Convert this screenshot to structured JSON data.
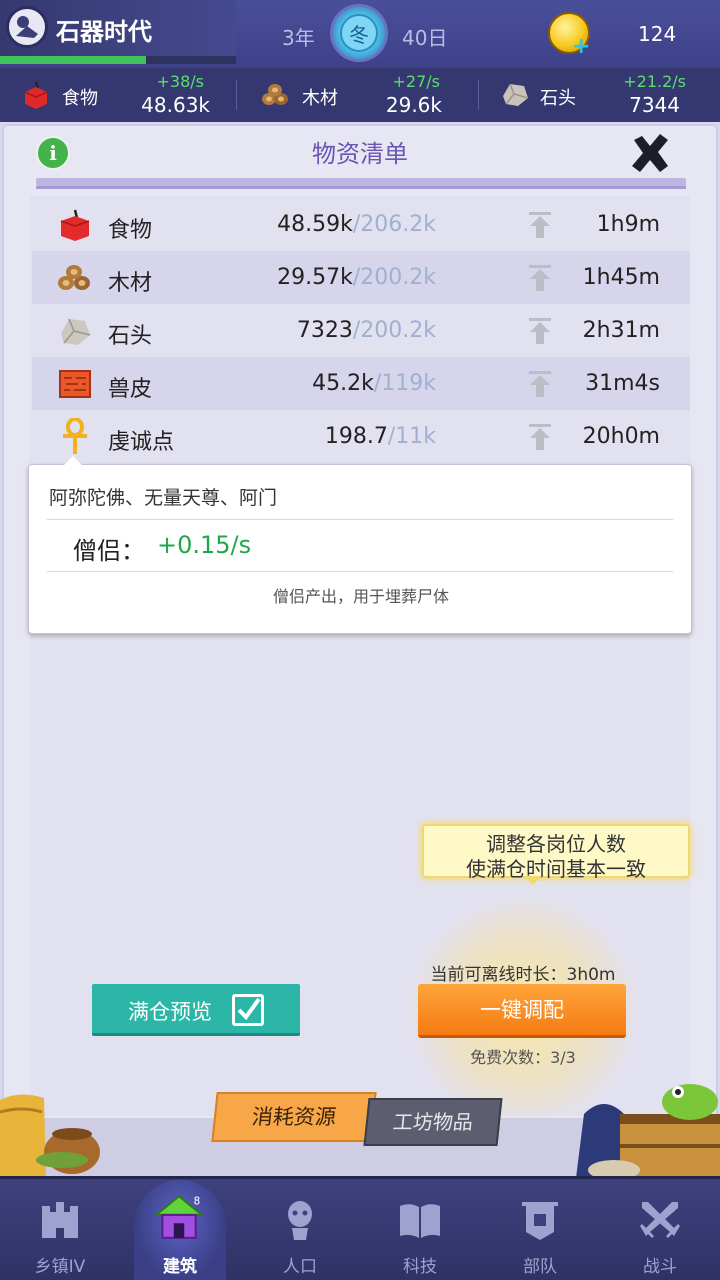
{
  "topbar": {
    "era_title": "石器时代",
    "year": "3年",
    "season": "冬",
    "day": "40日",
    "coins": "124",
    "era_progress": 0.62
  },
  "resource_strip": [
    {
      "name": "食物",
      "rate": "+38/s",
      "value": "48.63k",
      "icon": "food-icon"
    },
    {
      "name": "木材",
      "rate": "+27/s",
      "value": "29.6k",
      "icon": "wood-icon"
    },
    {
      "name": "石头",
      "rate": "+21.2/s",
      "value": "7344",
      "icon": "stone-icon"
    }
  ],
  "panel": {
    "title": "物资清单"
  },
  "table": [
    {
      "name": "食物",
      "current": "48.59k",
      "max": "/206.2k",
      "time": "1h9m",
      "icon": "food-icon"
    },
    {
      "name": "木材",
      "current": "29.57k",
      "max": "/200.2k",
      "time": "1h45m",
      "icon": "wood-icon"
    },
    {
      "name": "石头",
      "current": "7323",
      "max": "/200.2k",
      "time": "2h31m",
      "icon": "stone-icon"
    },
    {
      "name": "兽皮",
      "current": "45.2k",
      "max": "/119k",
      "time": "31m4s",
      "icon": "hide-icon"
    },
    {
      "name": "虔诚点",
      "current": "198.7",
      "max": "/11k",
      "time": "20h0m",
      "icon": "ankh-icon"
    }
  ],
  "tooltip": {
    "title": "阿弥陀佛、无量天尊、阿门",
    "producer_label": "僧侣：",
    "producer_value": "+0.15/s",
    "description": "僧侣产出，用于埋葬尸体"
  },
  "allocate": {
    "bubble_line1": "调整各岗位人数",
    "bubble_line2": "使满仓时间基本一致",
    "offline_label": "当前可离线时长：3h0m",
    "button_label": "一键调配",
    "free_count": "免费次数：3/3"
  },
  "preview": {
    "label": "满仓预览"
  },
  "tabs": {
    "consume": "消耗资源",
    "workshop": "工坊物品"
  },
  "nav": [
    {
      "label": "乡镇IV",
      "icon": "castle-icon"
    },
    {
      "label": "建筑",
      "icon": "house-icon",
      "active": true
    },
    {
      "label": "人口",
      "icon": "person-icon"
    },
    {
      "label": "科技",
      "icon": "book-icon"
    },
    {
      "label": "部队",
      "icon": "banner-icon"
    },
    {
      "label": "战斗",
      "icon": "crossed-swords-icon"
    }
  ]
}
